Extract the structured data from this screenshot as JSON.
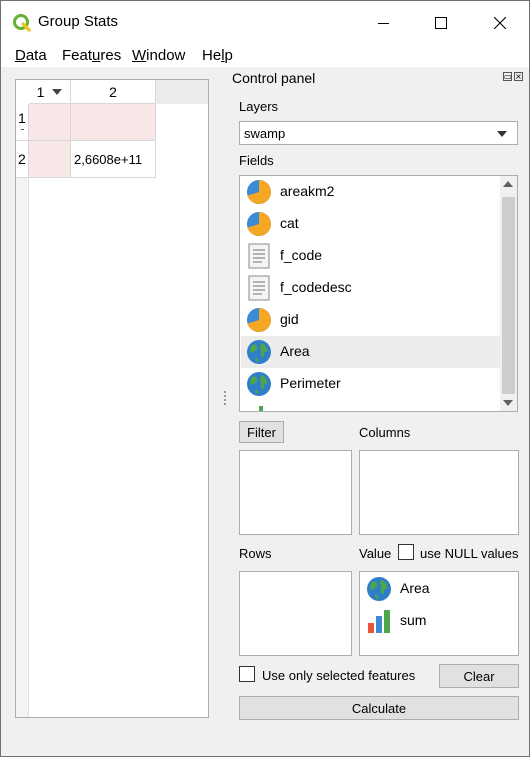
{
  "window": {
    "title": "Group Stats"
  },
  "menu": {
    "items": [
      {
        "pre": "",
        "ul": "D",
        "post": "ata"
      },
      {
        "pre": "Feat",
        "ul": "u",
        "post": "res"
      },
      {
        "pre": "",
        "ul": "W",
        "post": "indow"
      },
      {
        "pre": "He",
        "ul": "l",
        "post": "p"
      }
    ]
  },
  "table": {
    "columns": [
      "1",
      "2"
    ],
    "rows": [
      {
        "header": "1",
        "cells": [
          "",
          ""
        ]
      },
      {
        "header": "2",
        "cells": [
          "",
          "2,6608e+11"
        ]
      }
    ]
  },
  "control_panel": {
    "title": "Control panel",
    "layers_label": "Layers",
    "layer_value": "swamp",
    "fields_label": "Fields",
    "fields": [
      {
        "name": "areakm2",
        "icon": "pie-icon"
      },
      {
        "name": "cat",
        "icon": "pie-icon"
      },
      {
        "name": "f_code",
        "icon": "text-doc-icon"
      },
      {
        "name": "f_codedesc",
        "icon": "text-doc-icon"
      },
      {
        "name": "gid",
        "icon": "pie-icon"
      },
      {
        "name": "Area",
        "icon": "globe-icon",
        "selected": true
      },
      {
        "name": "Perimeter",
        "icon": "globe-icon"
      }
    ],
    "filter_button": "Filter",
    "columns_label": "Columns",
    "rows_label": "Rows",
    "value_label": "Value",
    "use_null_label": "use NULL values",
    "value_items": [
      {
        "name": "Area",
        "icon": "globe-icon"
      },
      {
        "name": "sum",
        "icon": "bar-chart-icon"
      }
    ],
    "use_selected_label": "Use only selected features",
    "clear_button": "Clear",
    "calculate_button": "Calculate"
  },
  "colors": {
    "selected_row": "#ececec",
    "empty_cell": "#f7e7e7",
    "accent": "#f5a623"
  }
}
